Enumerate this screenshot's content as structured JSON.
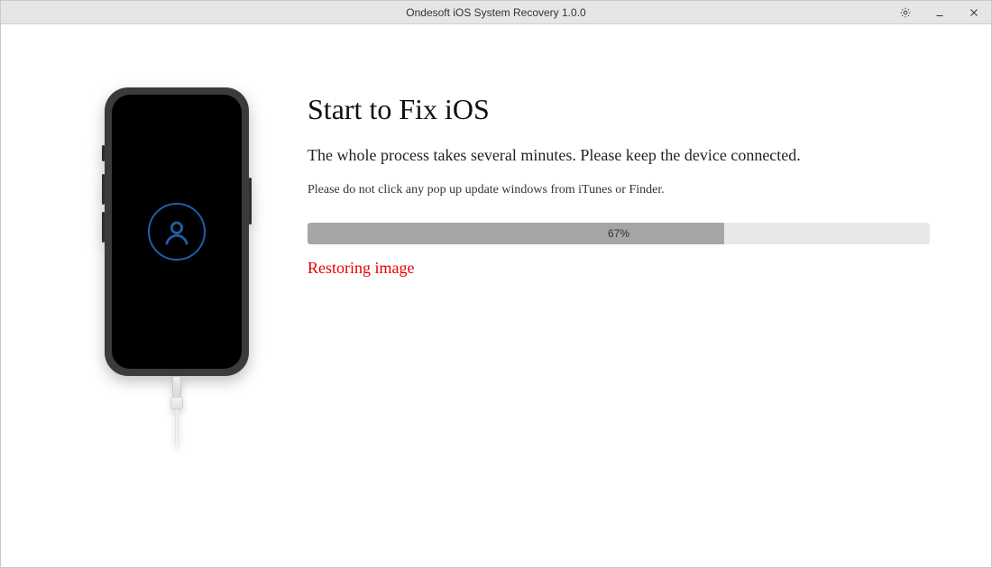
{
  "window": {
    "title": "Ondesoft iOS System Recovery 1.0.0"
  },
  "main": {
    "heading": "Start to Fix iOS",
    "subheading": "The whole process takes several minutes. Please keep the device connected.",
    "note": "Please do not click any pop up update windows from iTunes or Finder.",
    "progress_percent": 67,
    "progress_label": "67%",
    "status": "Restoring image"
  }
}
